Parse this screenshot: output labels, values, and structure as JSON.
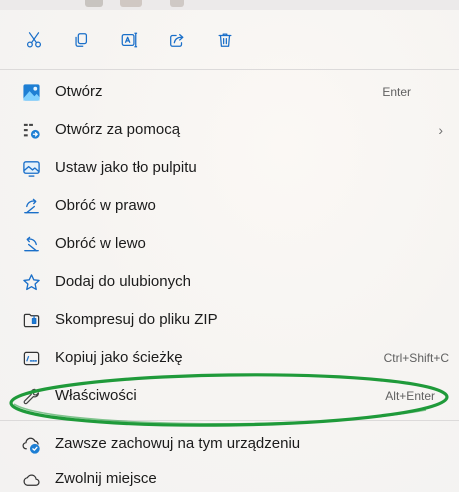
{
  "toolbar": {
    "buttons": [
      {
        "name": "cut",
        "icon": "scissors-icon"
      },
      {
        "name": "copy",
        "icon": "copy-icon"
      },
      {
        "name": "rename",
        "icon": "rename-icon"
      },
      {
        "name": "share",
        "icon": "share-icon"
      },
      {
        "name": "delete",
        "icon": "trash-icon"
      }
    ]
  },
  "menu": {
    "items": [
      {
        "label": "Otwórz",
        "shortcut": "Enter",
        "icon": "image-app-icon"
      },
      {
        "label": "Otwórz za pomocą",
        "arrow": "›",
        "icon": "open-with-icon"
      },
      {
        "label": "Ustaw jako tło pulpitu",
        "icon": "desktop-background-icon"
      },
      {
        "label": "Obróć w prawo",
        "icon": "rotate-right-icon"
      },
      {
        "label": "Obróć w lewo",
        "icon": "rotate-left-icon"
      },
      {
        "label": "Dodaj do ulubionych",
        "icon": "star-icon"
      },
      {
        "label": "Skompresuj do pliku ZIP",
        "icon": "zip-icon"
      },
      {
        "label": "Kopiuj jako ścieżkę",
        "shortcut": "Ctrl+Shift+C",
        "icon": "copy-path-icon"
      },
      {
        "label": "Właściwości",
        "shortcut": "Alt+Enter",
        "icon": "wrench-icon"
      },
      {
        "label": "Zawsze zachowuj na tym urządzeniu",
        "icon": "cloud-sync-icon"
      },
      {
        "label": "Zwolnij miejsce",
        "icon": "cloud-icon"
      }
    ]
  },
  "colors": {
    "accent": "#1a6fc9",
    "annotation": "#1f9a3a"
  }
}
